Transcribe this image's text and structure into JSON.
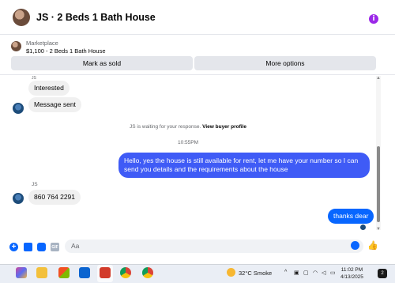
{
  "header": {
    "title": "JS · 2 Beds 1 Bath House",
    "info_icon": "info-icon",
    "accent": "#9b28e8"
  },
  "marketplace": {
    "label": "Marketplace",
    "listing": "$1,100 - 2 Beds 1 Bath House",
    "mark_sold": "Mark as sold",
    "more_options": "More options"
  },
  "messages": {
    "cut_name": "JS",
    "interested": "Interested",
    "message_sent": "Message sent",
    "waiting_prefix": "JS is waiting for your response.",
    "waiting_link": "View buyer profile",
    "time": "10:55PM",
    "outgoing_1": "Hello, yes the house is still available for rent, let me have your number so I can send you details and the requirements about the house",
    "sender_name": "JS",
    "phone": "860 764 2291",
    "outgoing_2": "thanks dear",
    "outgoing_color": "#3f5bf6",
    "reply_color": "#0866ff"
  },
  "composer": {
    "placeholder": "Aa",
    "gif_label": "GIF",
    "plus_symbol": "+",
    "like_symbol": "👍"
  },
  "taskbar": {
    "weather_temp": "32°C",
    "weather_desc": "Smoke",
    "time": "11:02 PM",
    "date": "4/13/2025",
    "notification_count": "2",
    "tray_chevron": "^"
  }
}
